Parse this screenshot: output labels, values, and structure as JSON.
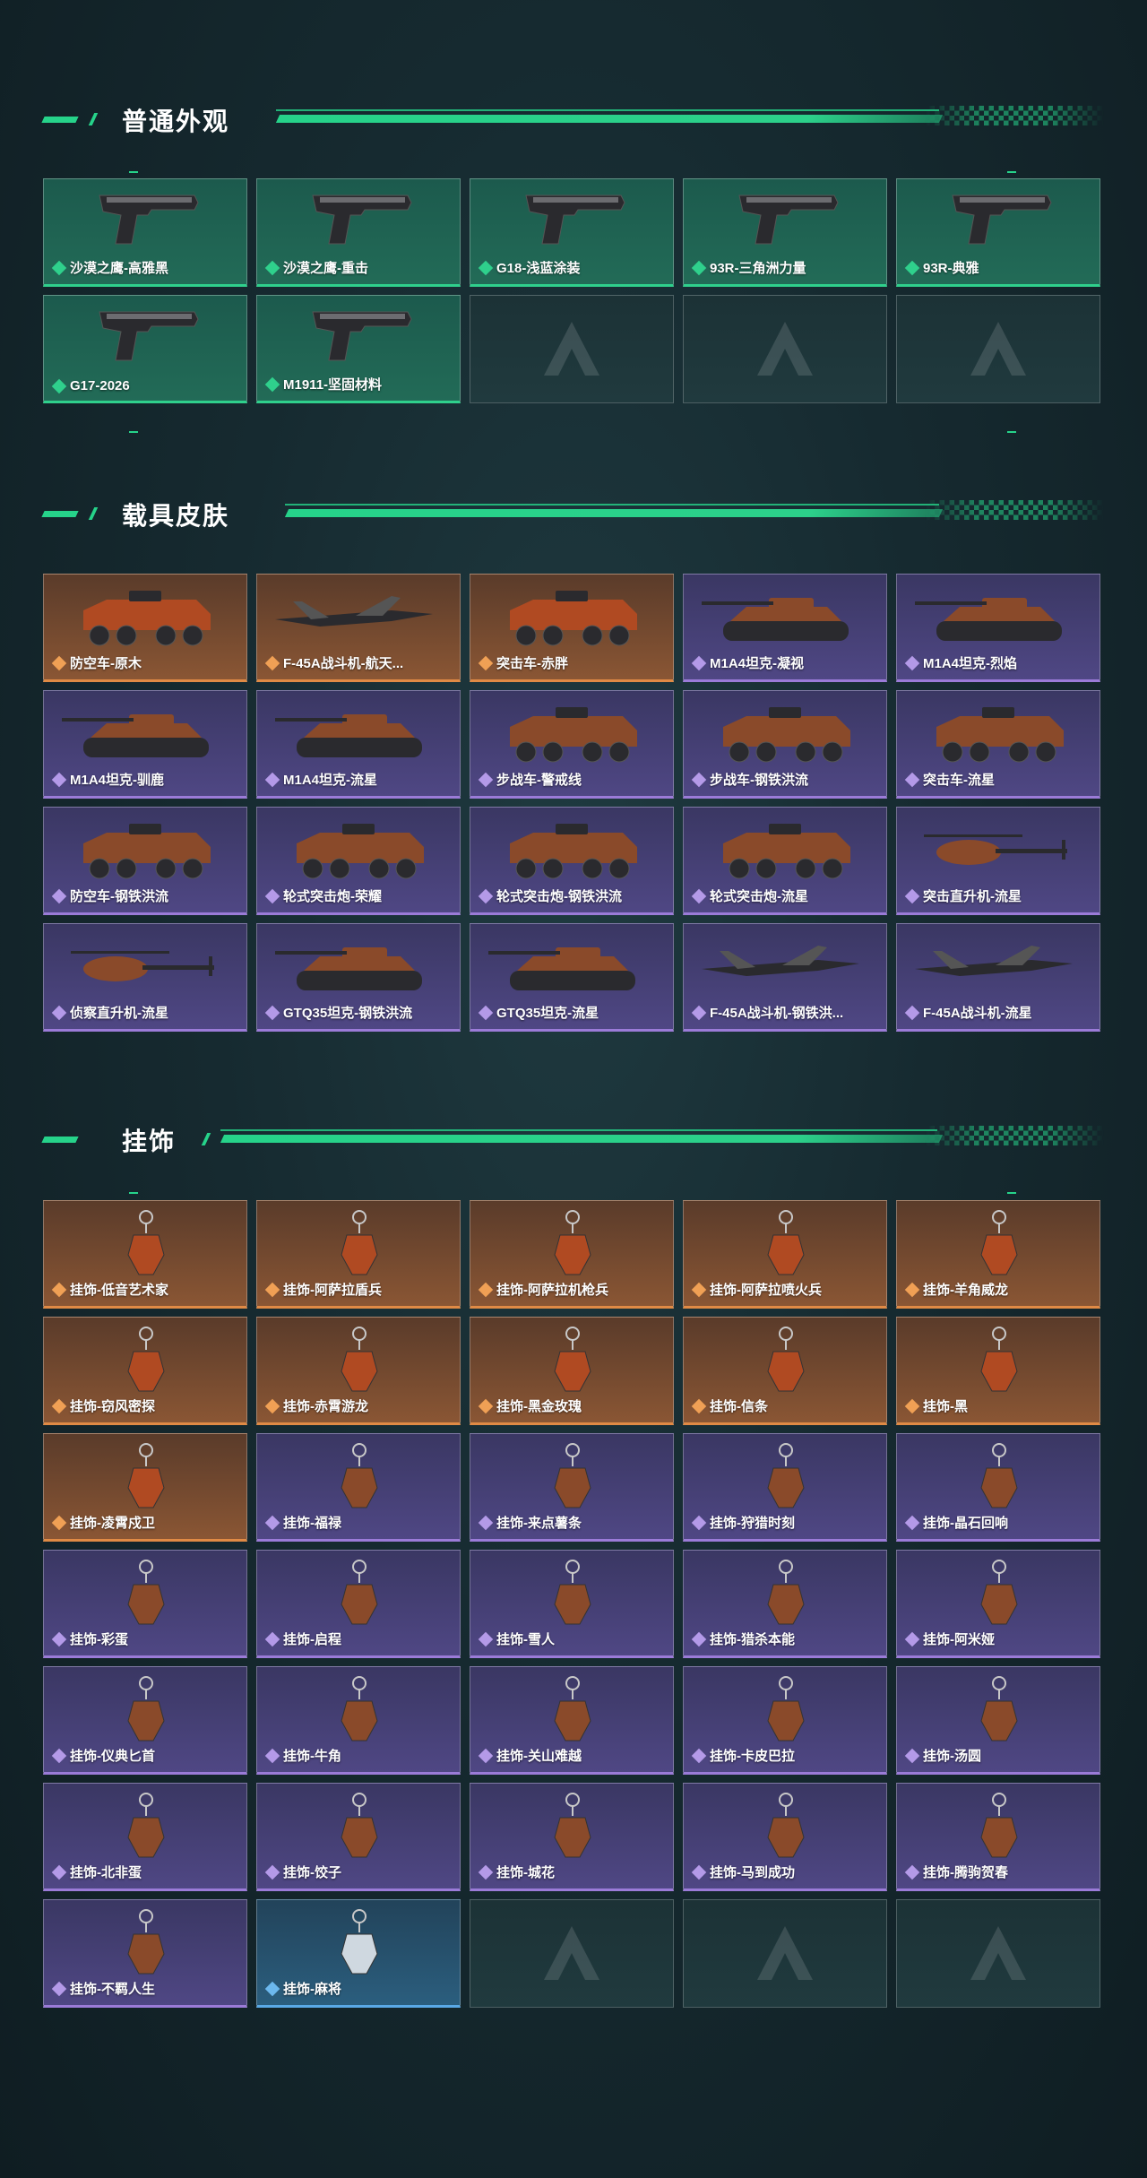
{
  "sections": {
    "weapons": {
      "title": "普通外观",
      "items": [
        {
          "label": "沙漠之鹰-高雅黑",
          "rarity": "green",
          "icon": "pistol-icon"
        },
        {
          "label": "沙漠之鹰-重击",
          "rarity": "green",
          "icon": "pistol-icon"
        },
        {
          "label": "G18-浅蓝涂装",
          "rarity": "green",
          "icon": "pistol-icon"
        },
        {
          "label": "93R-三角洲力量",
          "rarity": "green",
          "icon": "pistol-icon"
        },
        {
          "label": "93R-典雅",
          "rarity": "green",
          "icon": "pistol-icon"
        },
        {
          "label": "G17-2026",
          "rarity": "green",
          "icon": "pistol-icon"
        },
        {
          "label": "M1911-坚固材料",
          "rarity": "green",
          "icon": "pistol-icon"
        }
      ],
      "empty_slots": 3
    },
    "vehicles": {
      "title": "载具皮肤",
      "items": [
        {
          "label": "防空车-原木",
          "rarity": "orange",
          "icon": "armored-vehicle-icon"
        },
        {
          "label": "F-45A战斗机-航天...",
          "rarity": "orange",
          "icon": "jet-icon"
        },
        {
          "label": "突击车-赤胖",
          "rarity": "orange",
          "icon": "assault-car-icon"
        },
        {
          "label": "M1A4坦克-凝视",
          "rarity": "purple",
          "icon": "tank-icon"
        },
        {
          "label": "M1A4坦克-烈焰",
          "rarity": "purple",
          "icon": "tank-icon"
        },
        {
          "label": "M1A4坦克-驯鹿",
          "rarity": "purple",
          "icon": "tank-icon"
        },
        {
          "label": "M1A4坦克-流星",
          "rarity": "purple",
          "icon": "tank-icon"
        },
        {
          "label": "步战车-警戒线",
          "rarity": "purple",
          "icon": "armored-vehicle-icon"
        },
        {
          "label": "步战车-钢铁洪流",
          "rarity": "purple",
          "icon": "armored-vehicle-icon"
        },
        {
          "label": "突击车-流星",
          "rarity": "purple",
          "icon": "assault-car-icon"
        },
        {
          "label": "防空车-钢铁洪流",
          "rarity": "purple",
          "icon": "armored-vehicle-icon"
        },
        {
          "label": "轮式突击炮-荣耀",
          "rarity": "purple",
          "icon": "wheeled-gun-icon"
        },
        {
          "label": "轮式突击炮-钢铁洪流",
          "rarity": "purple",
          "icon": "wheeled-gun-icon"
        },
        {
          "label": "轮式突击炮-流星",
          "rarity": "purple",
          "icon": "wheeled-gun-icon"
        },
        {
          "label": "突击直升机-流星",
          "rarity": "purple",
          "icon": "helicopter-icon"
        },
        {
          "label": "侦察直升机-流星",
          "rarity": "purple",
          "icon": "helicopter-icon"
        },
        {
          "label": "GTQ35坦克-钢铁洪流",
          "rarity": "purple",
          "icon": "tank-icon"
        },
        {
          "label": "GTQ35坦克-流星",
          "rarity": "purple",
          "icon": "tank-icon"
        },
        {
          "label": "F-45A战斗机-钢铁洪...",
          "rarity": "purple",
          "icon": "jet-icon"
        },
        {
          "label": "F-45A战斗机-流星",
          "rarity": "purple",
          "icon": "jet-icon"
        }
      ],
      "empty_slots": 0
    },
    "charms": {
      "title": "挂饰",
      "items": [
        {
          "label": "挂饰-低音艺术家",
          "rarity": "orange",
          "icon": "charm-icon"
        },
        {
          "label": "挂饰-阿萨拉盾兵",
          "rarity": "orange",
          "icon": "charm-icon"
        },
        {
          "label": "挂饰-阿萨拉机枪兵",
          "rarity": "orange",
          "icon": "charm-icon"
        },
        {
          "label": "挂饰-阿萨拉喷火兵",
          "rarity": "orange",
          "icon": "charm-icon"
        },
        {
          "label": "挂饰-羊角威龙",
          "rarity": "orange",
          "icon": "charm-icon"
        },
        {
          "label": "挂饰-窃风密探",
          "rarity": "orange",
          "icon": "charm-icon"
        },
        {
          "label": "挂饰-赤霄游龙",
          "rarity": "orange",
          "icon": "charm-icon"
        },
        {
          "label": "挂饰-黑金玫瑰",
          "rarity": "orange",
          "icon": "charm-icon"
        },
        {
          "label": "挂饰-信条",
          "rarity": "orange",
          "icon": "charm-icon"
        },
        {
          "label": "挂饰-黑",
          "rarity": "orange",
          "icon": "charm-icon"
        },
        {
          "label": "挂饰-凌霄戍卫",
          "rarity": "orange",
          "icon": "charm-icon"
        },
        {
          "label": "挂饰-福禄",
          "rarity": "purple",
          "icon": "charm-icon"
        },
        {
          "label": "挂饰-来点薯条",
          "rarity": "purple",
          "icon": "charm-icon"
        },
        {
          "label": "挂饰-狩猎时刻",
          "rarity": "purple",
          "icon": "charm-icon"
        },
        {
          "label": "挂饰-晶石回响",
          "rarity": "purple",
          "icon": "charm-icon"
        },
        {
          "label": "挂饰-彩蛋",
          "rarity": "purple",
          "icon": "charm-icon"
        },
        {
          "label": "挂饰-启程",
          "rarity": "purple",
          "icon": "charm-icon"
        },
        {
          "label": "挂饰-雪人",
          "rarity": "purple",
          "icon": "charm-icon"
        },
        {
          "label": "挂饰-猎杀本能",
          "rarity": "purple",
          "icon": "charm-icon"
        },
        {
          "label": "挂饰-阿米娅",
          "rarity": "purple",
          "icon": "charm-icon"
        },
        {
          "label": "挂饰-仪典匕首",
          "rarity": "purple",
          "icon": "charm-icon"
        },
        {
          "label": "挂饰-牛角",
          "rarity": "purple",
          "icon": "charm-icon"
        },
        {
          "label": "挂饰-关山难越",
          "rarity": "purple",
          "icon": "charm-icon"
        },
        {
          "label": "挂饰-卡皮巴拉",
          "rarity": "purple",
          "icon": "charm-icon"
        },
        {
          "label": "挂饰-汤圆",
          "rarity": "purple",
          "icon": "charm-icon"
        },
        {
          "label": "挂饰-北非蛋",
          "rarity": "purple",
          "icon": "charm-icon"
        },
        {
          "label": "挂饰-饺子",
          "rarity": "purple",
          "icon": "charm-icon"
        },
        {
          "label": "挂饰-城花",
          "rarity": "purple",
          "icon": "charm-icon"
        },
        {
          "label": "挂饰-马到成功",
          "rarity": "purple",
          "icon": "charm-icon"
        },
        {
          "label": "挂饰-腾驹贺春",
          "rarity": "purple",
          "icon": "charm-icon"
        },
        {
          "label": "挂饰-不羁人生",
          "rarity": "purple",
          "icon": "charm-icon"
        },
        {
          "label": "挂饰-麻将",
          "rarity": "blue",
          "icon": "charm-icon"
        }
      ],
      "empty_slots": 3
    }
  },
  "colors": {
    "accent": "#26d38a",
    "green": "#2fd08c",
    "orange": "#e08a45",
    "purple": "#9b7bd8",
    "blue": "#5aa9e6"
  }
}
